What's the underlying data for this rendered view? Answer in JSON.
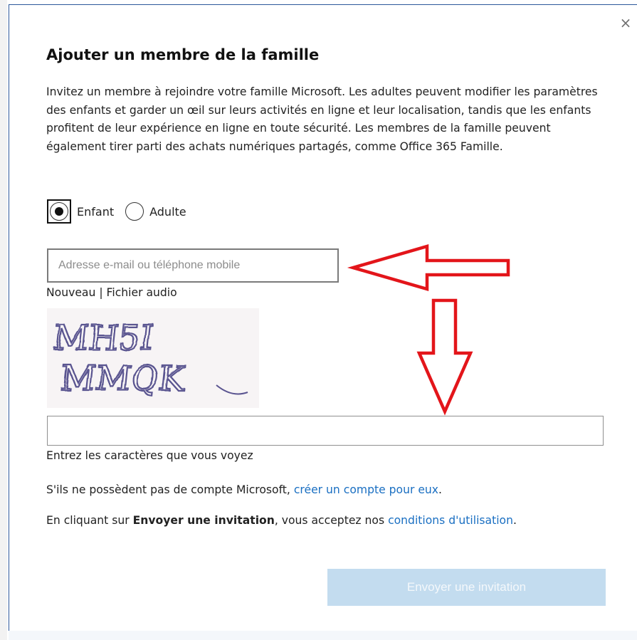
{
  "dialog": {
    "close_glyph": "×",
    "title": "Ajouter un membre de la famille",
    "description": "Invitez un membre à rejoindre votre famille Microsoft. Les adultes peuvent modifier les paramètres des enfants et garder un œil sur leurs activités en ligne et leur localisation, tandis que les enfants profitent de leur expérience en ligne en toute sécurité. Les membres de la famille peuvent également tirer parti des achats numériques partagés, comme Office 365 Famille."
  },
  "member_type": {
    "options": [
      {
        "label": "Enfant",
        "selected": true
      },
      {
        "label": "Adulte",
        "selected": false
      }
    ]
  },
  "email_field": {
    "placeholder": "Adresse e-mail ou téléphone mobile",
    "value": ""
  },
  "captcha": {
    "new_label": "Nouveau",
    "separator": " | ",
    "audio_label": "Fichier audio",
    "image_text_line1": "MH5I",
    "image_text_line2": "MMQK",
    "input_value": "",
    "hint": "Entrez les caractères que vous voyez"
  },
  "no_account": {
    "text": "S'ils ne possèdent pas de compte Microsoft,",
    "link": "créer un compte pour eux",
    "suffix": "."
  },
  "terms": {
    "prefix": "En cliquant sur ",
    "bold": "Envoyer une invitation",
    "middle": ", vous acceptez nos ",
    "link": "conditions d'utilisation",
    "suffix": "."
  },
  "send_button": {
    "label": "Envoyer une invitation",
    "enabled": false
  },
  "colors": {
    "accent": "#1a6fc2",
    "button_disabled_bg": "#c3dcef",
    "annotation_arrow": "#e3151a",
    "window_border": "#2b579a"
  }
}
